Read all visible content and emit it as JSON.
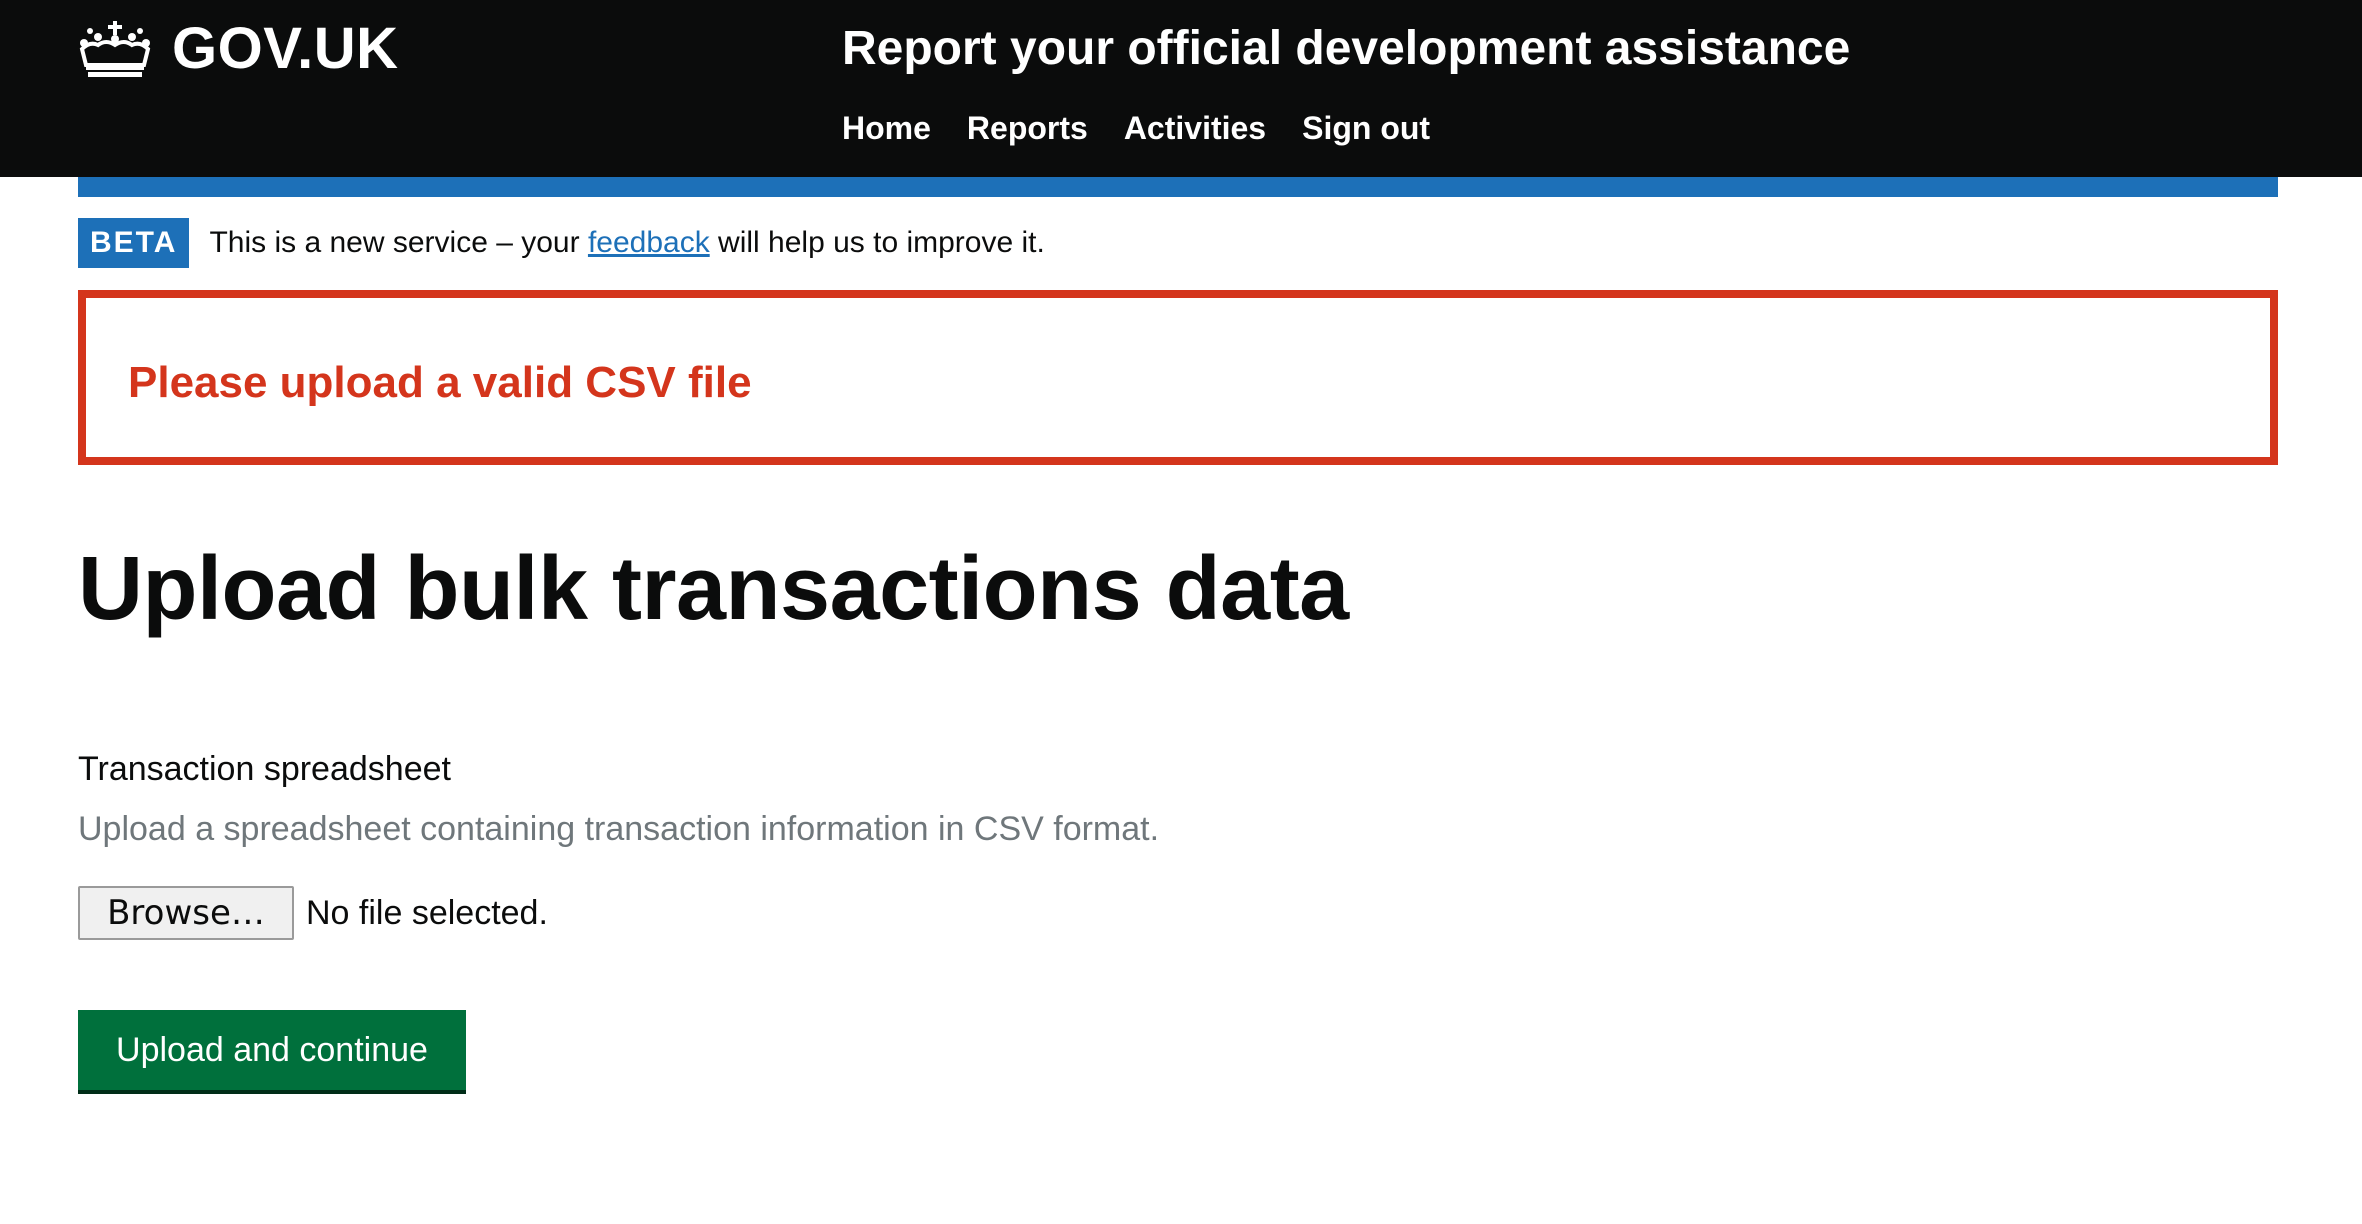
{
  "header": {
    "logo_text": "GOV.UK",
    "service_name": "Report your official development assistance",
    "nav": [
      {
        "label": "Home"
      },
      {
        "label": "Reports"
      },
      {
        "label": "Activities"
      },
      {
        "label": "Sign out"
      }
    ]
  },
  "phase_banner": {
    "tag": "BETA",
    "text_before": "This is a new service – your ",
    "link": "feedback",
    "text_after": " will help us to improve it."
  },
  "error_summary": {
    "message": "Please upload a valid CSV file"
  },
  "main": {
    "title": "Upload bulk transactions data",
    "field": {
      "label": "Transaction spreadsheet",
      "hint": "Upload a spreadsheet containing transaction information in CSV format.",
      "browse_label": "Browse…",
      "file_status": "No file selected."
    },
    "submit_label": "Upload and continue"
  },
  "colors": {
    "header_bg": "#0b0c0c",
    "brand_blue": "#1d70b8",
    "error_red": "#d4351c",
    "button_green": "#00703c",
    "hint_grey": "#6f777b"
  },
  "icons": {
    "logo": "crown-icon"
  }
}
